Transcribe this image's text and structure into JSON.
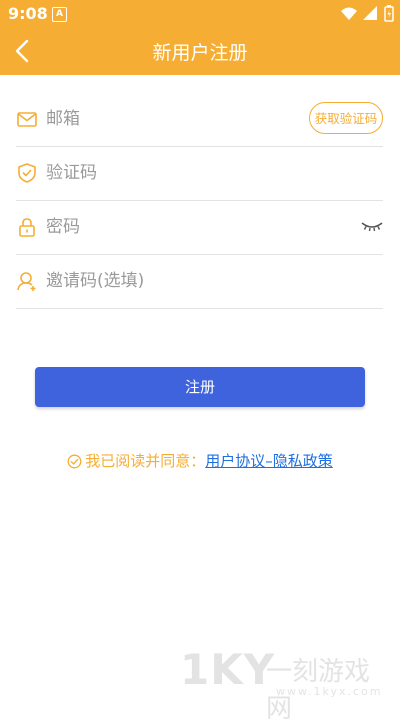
{
  "status_bar": {
    "time": "9:08",
    "badge": "A"
  },
  "header": {
    "title": "新用户注册"
  },
  "form": {
    "email": {
      "placeholder": "邮箱",
      "value": ""
    },
    "get_code_label": "获取验证码",
    "code": {
      "placeholder": "验证码",
      "value": ""
    },
    "password": {
      "placeholder": "密码",
      "value": ""
    },
    "invite": {
      "placeholder": "邀请码(选填)",
      "value": ""
    }
  },
  "register_label": "注册",
  "agreement": {
    "prefix": "我已阅读并同意：",
    "link": "用户协议–隐私政策"
  },
  "watermark": {
    "logo": "1KY",
    "name": "一刻游戏网",
    "url": "www.1kyx.com"
  },
  "colors": {
    "accent": "#f6ad33",
    "primary": "#3e63dd",
    "link": "#1f6fe0"
  }
}
